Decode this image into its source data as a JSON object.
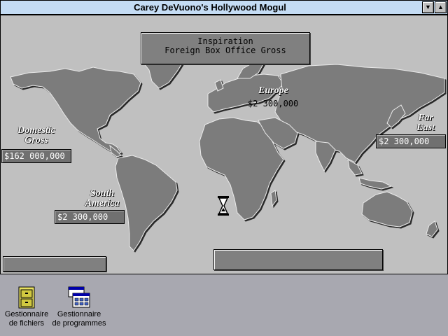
{
  "window": {
    "title": "Carey DeVuono's Hollywood Mogul",
    "minimize_glyph": "▼",
    "maximize_glyph": "▲"
  },
  "inspiration": {
    "line1": "Inspiration",
    "line2": "Foreign Box Office Gross"
  },
  "regions": {
    "domestic": {
      "label1": "Domestic",
      "label2": "Gross",
      "value": "$162 000,000"
    },
    "europe": {
      "label": "Europe",
      "value": "$2 300,000"
    },
    "far_east": {
      "label1": "Far",
      "label2": "East",
      "value": "$2 300,000"
    },
    "south_america": {
      "label1": "South",
      "label2": "America",
      "value": "$2 300,000"
    }
  },
  "desktop_icons": [
    {
      "name": "file-manager",
      "label1": "Gestionnaire",
      "label2": "de fichiers",
      "icon": "cabinet-icon"
    },
    {
      "name": "program-manager",
      "label1": "Gestionnaire",
      "label2": "de programmes",
      "icon": "program-manager-icon"
    }
  ],
  "colors": {
    "desktop": "#a8a8b0",
    "window_bg": "#c0c0c0",
    "titlebar": "#c4dcf4",
    "land": "#7c7c7c"
  }
}
